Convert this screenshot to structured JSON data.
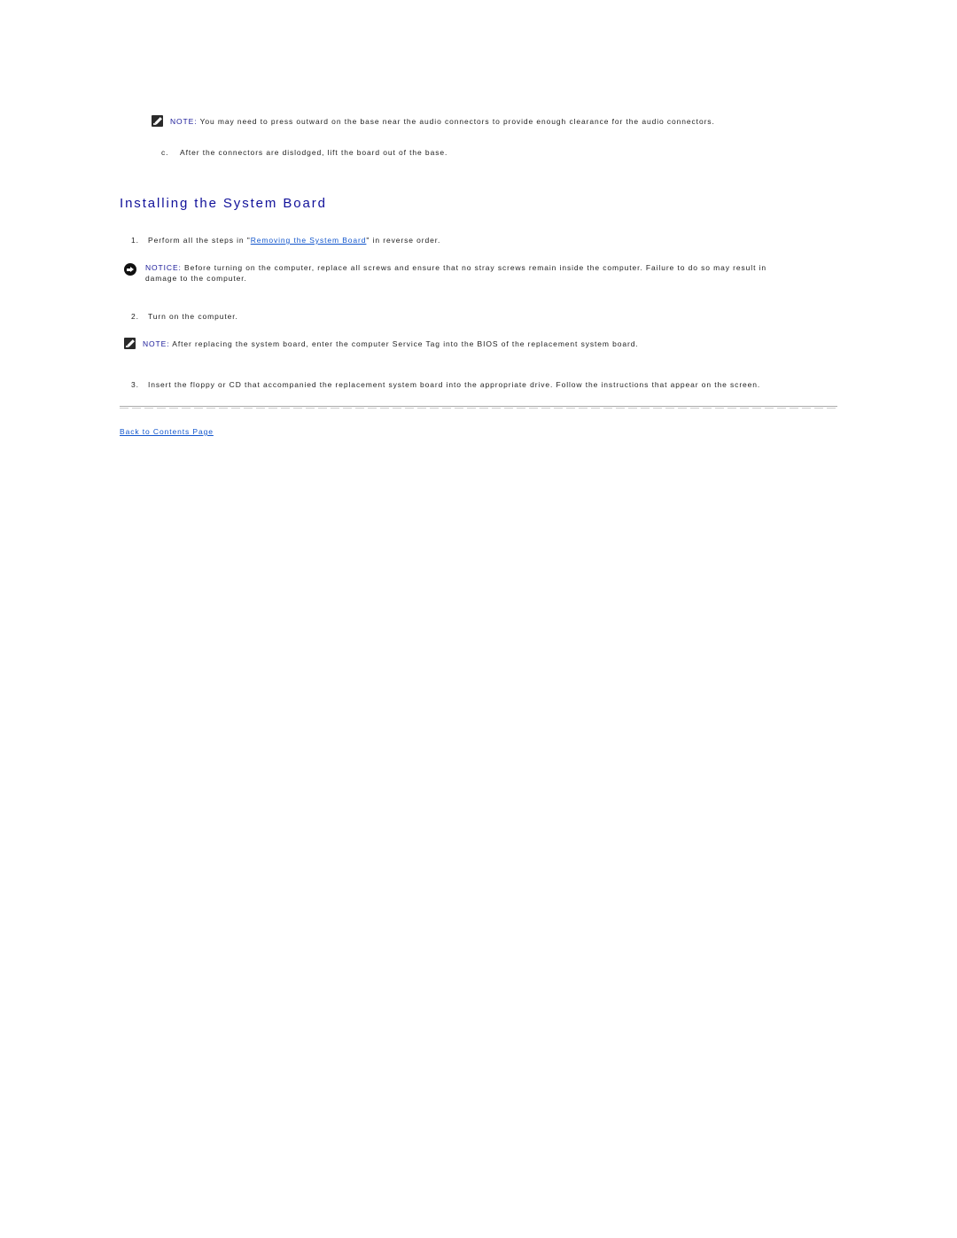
{
  "note1": {
    "icon": "note-pencil-icon",
    "label": "NOTE:",
    "text": " You may need to press outward on the base near the audio connectors to provide enough clearance for the audio connectors."
  },
  "step_c": {
    "marker": "c.",
    "text": "After the connectors are dislodged, lift the board out of the base."
  },
  "section": {
    "heading": "Installing the System Board"
  },
  "step1": {
    "marker": "1.",
    "text_before": "Perform all the steps in \"",
    "link": "Removing the System Board",
    "text_after": "\" in reverse order."
  },
  "notice": {
    "icon": "notice-arrow-icon",
    "label": "NOTICE:",
    "line1": " Before turning on the computer, replace all screws and ensure that no stray screws remain inside the computer. Failure to do so may result in",
    "line2": "damage to the computer."
  },
  "step2": {
    "marker": "2.",
    "text": "Turn on the computer."
  },
  "note2": {
    "icon": "note-pencil-icon",
    "label": "NOTE:",
    "text": " After replacing the system board, enter the computer Service Tag into the BIOS of the replacement system board."
  },
  "step3": {
    "marker": "3.",
    "text": "Insert the floppy or CD that accompanied the replacement system board into the appropriate drive. Follow the instructions that appear on the screen."
  },
  "footer": {
    "back_link": "Back to Contents Page"
  }
}
